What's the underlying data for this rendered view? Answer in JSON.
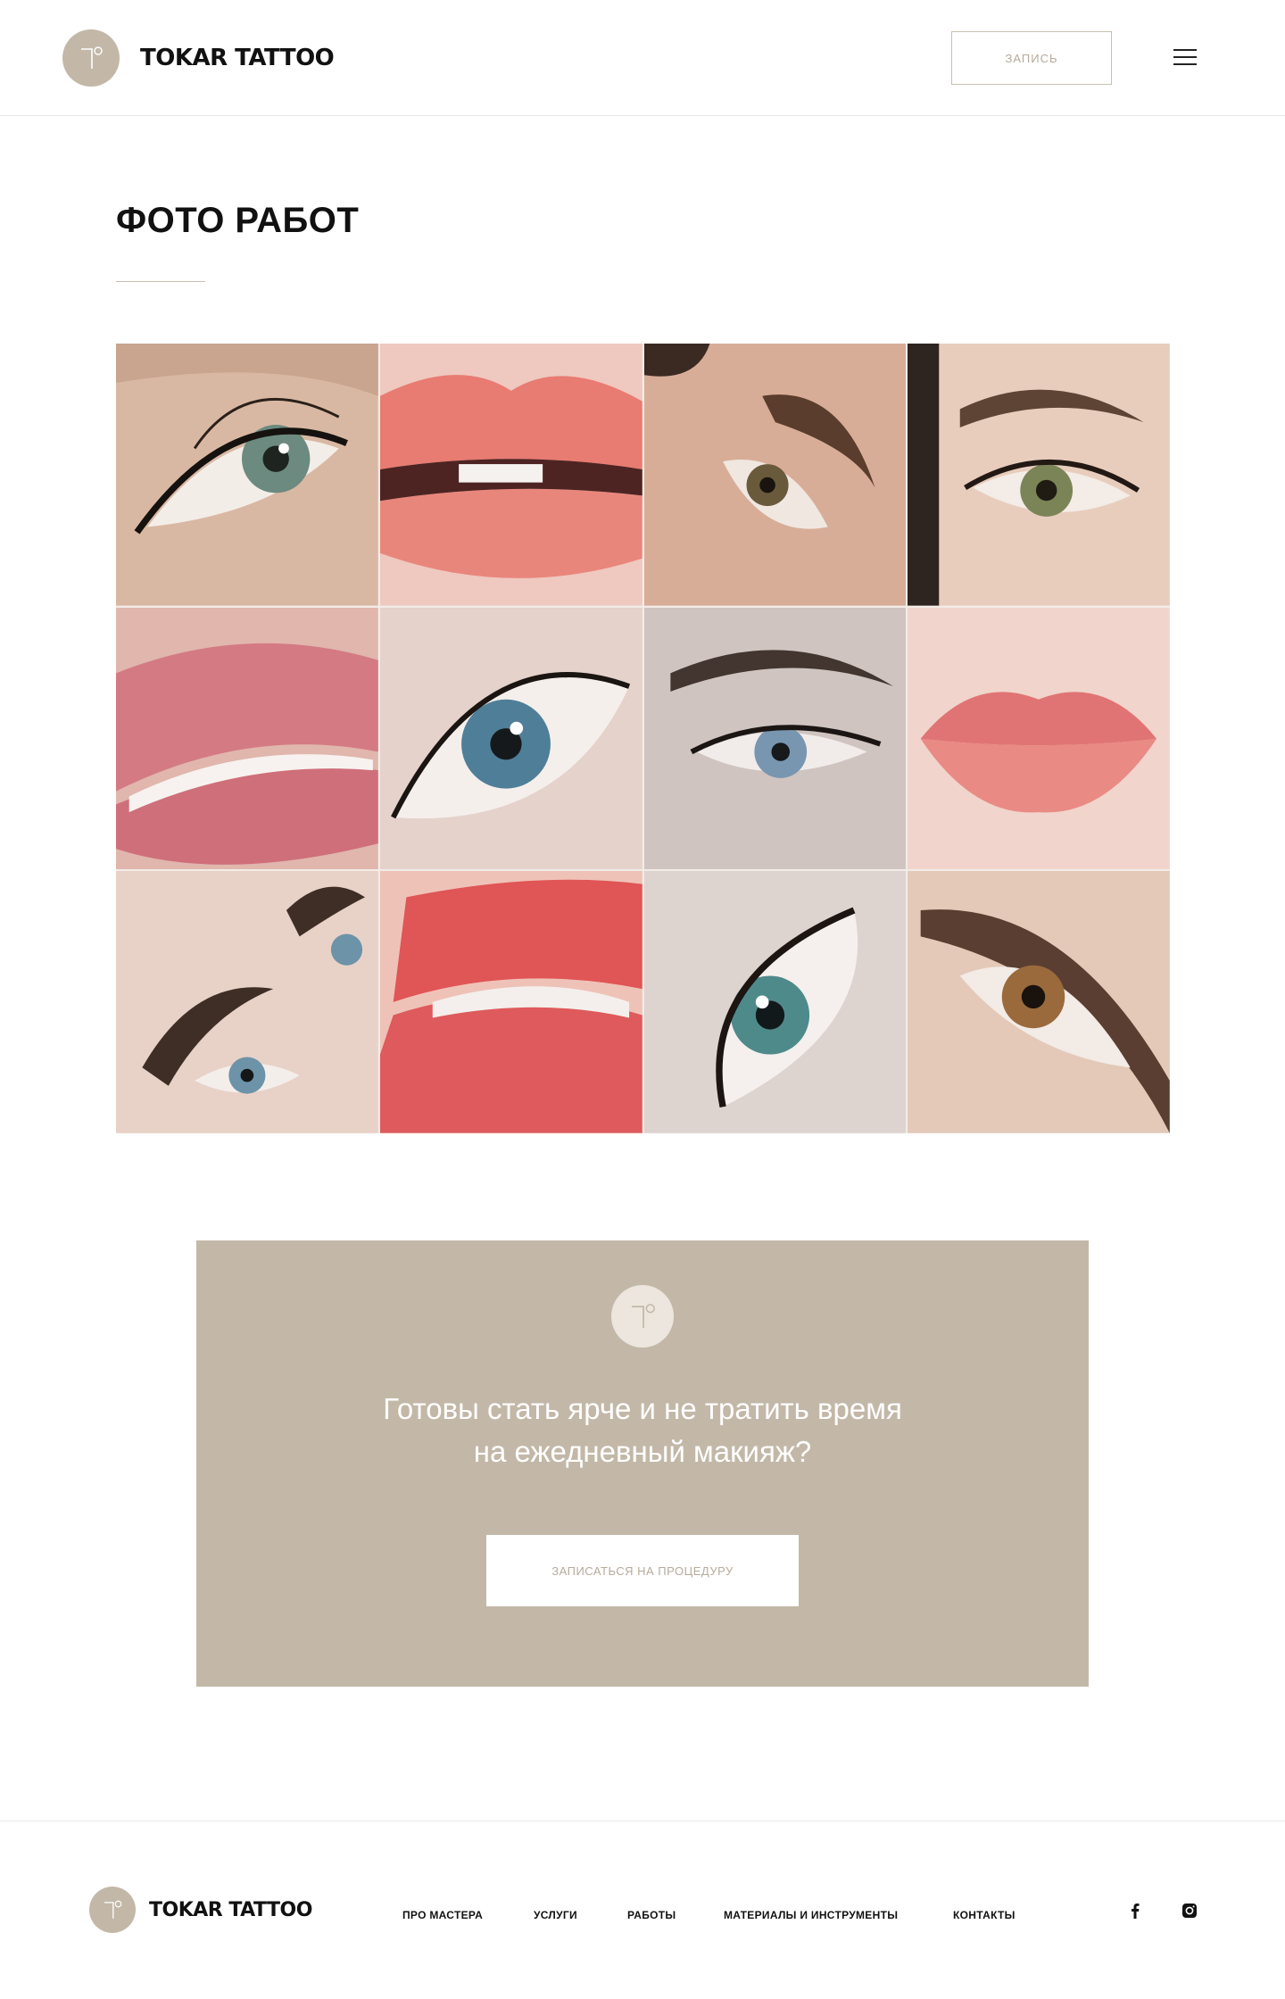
{
  "header": {
    "brand": "TOKAR TATTOO",
    "book_label": "ЗАПИСЬ"
  },
  "works": {
    "title": "ФОТО РАБОТ",
    "photos": [
      {
        "subject": "eyeliner"
      },
      {
        "subject": "lips"
      },
      {
        "subject": "eyebrows"
      },
      {
        "subject": "eyebrows-eyeliner"
      },
      {
        "subject": "lips"
      },
      {
        "subject": "eyeliner"
      },
      {
        "subject": "eyeliner"
      },
      {
        "subject": "lips"
      },
      {
        "subject": "eyebrows"
      },
      {
        "subject": "lips"
      },
      {
        "subject": "eyeliner"
      },
      {
        "subject": "eyeliner"
      }
    ]
  },
  "cta": {
    "line1": "Готовы стать ярче и не тратить время",
    "line2": "на ежедневный макияж?",
    "button_label": "ЗАПИСАТЬСЯ НА ПРОЦЕДУРУ"
  },
  "footer": {
    "brand": "TOKAR TATTOO",
    "nav": [
      {
        "label": "ПРО МАСТЕРА"
      },
      {
        "label": "УСЛУГИ"
      },
      {
        "label": "РАБОТЫ"
      },
      {
        "label": "МАТЕРИАЛЫ И ИНСТРУМЕНТЫ"
      },
      {
        "label": "КОНТАКТЫ"
      }
    ],
    "social": [
      {
        "icon": "facebook-icon"
      },
      {
        "icon": "instagram-icon"
      }
    ]
  },
  "colors": {
    "accent": "#c3b8a8",
    "button_text": "#b6aa9a"
  }
}
